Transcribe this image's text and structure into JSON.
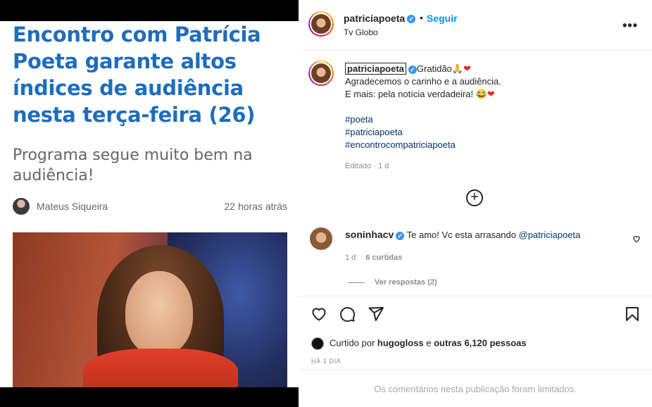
{
  "article": {
    "headline_lines": [
      "Encontro com Patrícia",
      "Poeta garante altos",
      "índices de audiência",
      "nesta terça-feira (26)"
    ],
    "subhead_lines": [
      "Programa segue muito bem na",
      "audiência!"
    ],
    "author": "Mateus Siqueira",
    "time_ago": "22 horas atrás"
  },
  "post": {
    "header": {
      "username": "patriciapoeta",
      "separator": "•",
      "follow_label": "Seguir",
      "subtitle": "Tv Globo",
      "more_icon": "more-horizontal-icon"
    },
    "caption": {
      "username": "patriciapoeta",
      "line1": "Gratidão🙏",
      "line2": "Agradecemos o carinho e a audiência.",
      "line3": "E mais: pela notícia verdadeira! 😂",
      "heart": "❤",
      "hashtags": [
        "#poeta",
        "#patriciapoeta",
        "#encontrocompatriciapoeta"
      ],
      "edited": "Editado · 1 d"
    },
    "load_more_icon": "plus-circle-icon",
    "comment": {
      "username": "soninhacv",
      "text": "Te amo! Vc esta arrasando ",
      "mention": "@patriciapoeta",
      "age": "1 d",
      "likes": "6 curtidas",
      "replies": "Ver respostas (2)"
    },
    "actions": {
      "icons": [
        "heart-icon",
        "comment-icon",
        "share-icon",
        "bookmark-icon"
      ]
    },
    "liked_by": {
      "prefix": "Curtido por ",
      "user": "hugogloss",
      "middle": " e ",
      "others": "outras 6,120 pessoas"
    },
    "time_label": "HÁ 1 DIA",
    "limited_notice": "Os comentários nesta publicação foram limitados."
  },
  "colors": {
    "headline": "#1e6dbd",
    "link": "#00376b",
    "follow": "#0095f6",
    "verified": "#3897f0"
  }
}
